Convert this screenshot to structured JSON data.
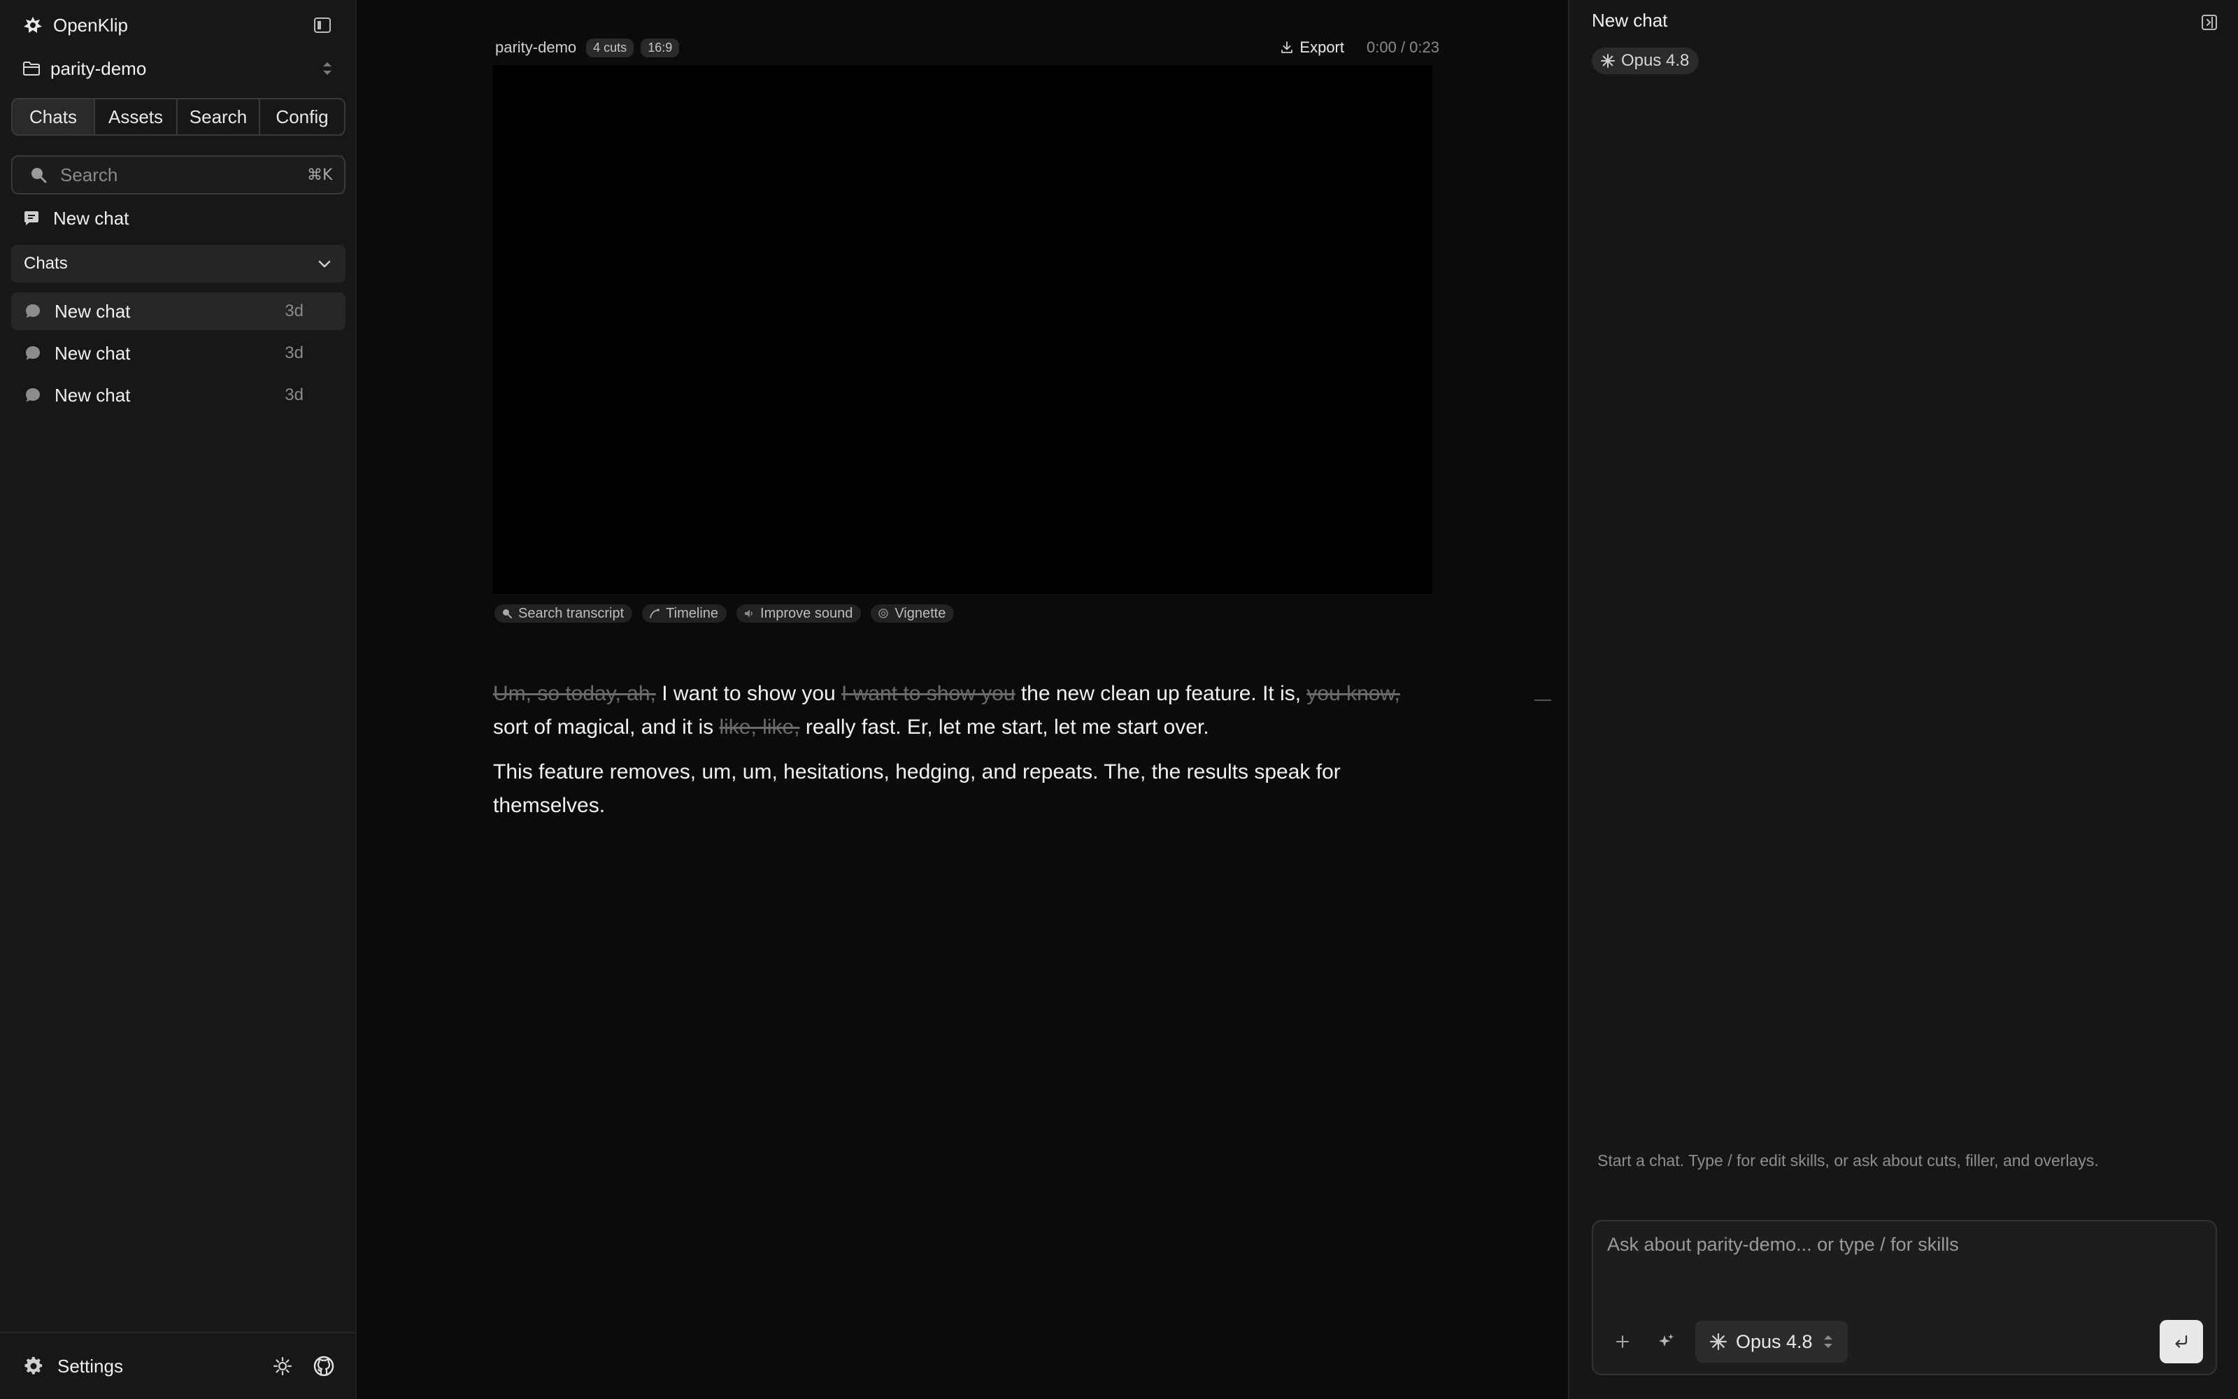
{
  "app": {
    "name": "OpenKlip"
  },
  "project": {
    "name": "parity-demo"
  },
  "sidebar": {
    "tabs": [
      {
        "label": "Chats",
        "active": true
      },
      {
        "label": "Assets",
        "active": false
      },
      {
        "label": "Search",
        "active": false
      },
      {
        "label": "Config",
        "active": false
      }
    ],
    "search": {
      "placeholder": "Search",
      "shortcut": "⌘K"
    },
    "new_chat_label": "New chat",
    "section_title": "Chats",
    "chats": [
      {
        "title": "New chat",
        "age": "3d",
        "selected": true
      },
      {
        "title": "New chat",
        "age": "3d",
        "selected": false
      },
      {
        "title": "New chat",
        "age": "3d",
        "selected": false
      }
    ],
    "footer": {
      "settings_label": "Settings"
    }
  },
  "editor": {
    "project_label": "parity-demo",
    "cuts_badge": "4 cuts",
    "aspect_badge": "16:9",
    "export_label": "Export",
    "time_current": "0:00",
    "time_separator": " / ",
    "time_total": "0:23",
    "tools": [
      {
        "label": "Search transcript",
        "icon": "search-icon"
      },
      {
        "label": "Timeline",
        "icon": "timeline-icon"
      },
      {
        "label": "Improve sound",
        "icon": "speaker-icon"
      },
      {
        "label": "Vignette",
        "icon": "vignette-icon"
      }
    ],
    "transcript": {
      "p1": [
        {
          "text": "Um, so today, ah,",
          "cut": true
        },
        {
          "text": " I want to show you ",
          "cut": false
        },
        {
          "text": "I want to show you",
          "cut": true
        },
        {
          "text": " the new clean up feature. It is, ",
          "cut": false
        },
        {
          "text": "you know,",
          "cut": true
        },
        {
          "text": " sort of magical, and it is ",
          "cut": false
        },
        {
          "text": "like, like,",
          "cut": true
        },
        {
          "text": " really fast. Er, let me start, let me start over.",
          "cut": false
        }
      ],
      "p2": "This feature removes, um, um, hesitations, hedging, and repeats. The, the results speak for themselves."
    }
  },
  "chat_panel": {
    "title": "New chat",
    "model_badge": "Opus 4.8",
    "empty_hint": "Start a chat. Type / for edit skills, or ask about cuts, filler, and overlays.",
    "composer_placeholder": "Ask about parity-demo... or type / for skills",
    "model_select": "Opus 4.8"
  },
  "colors": {
    "background": "#0b0b0b",
    "sidebar": "#171717",
    "panel": "#161616",
    "cut_text": "#6b6b6b",
    "send_button": "#e9e9e9"
  }
}
